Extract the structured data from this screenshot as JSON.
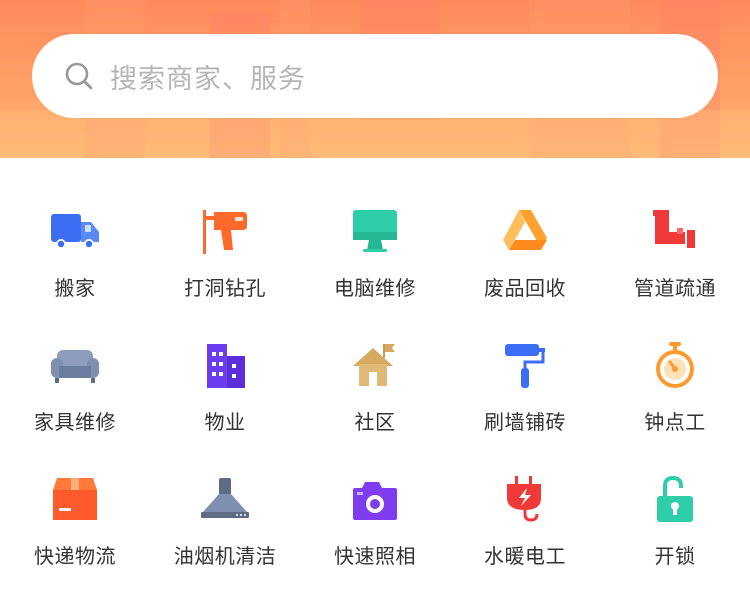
{
  "search": {
    "placeholder": "搜索商家、服务"
  },
  "services": [
    {
      "label": "搬家",
      "icon": "truck-icon"
    },
    {
      "label": "打洞钻孔",
      "icon": "drill-icon"
    },
    {
      "label": "电脑维修",
      "icon": "monitor-icon"
    },
    {
      "label": "废品回收",
      "icon": "recycle-icon"
    },
    {
      "label": "管道疏通",
      "icon": "pipe-icon"
    },
    {
      "label": "家具维修",
      "icon": "sofa-icon"
    },
    {
      "label": "物业",
      "icon": "building-icon"
    },
    {
      "label": "社区",
      "icon": "house-flag-icon"
    },
    {
      "label": "刷墙铺砖",
      "icon": "paint-roller-icon"
    },
    {
      "label": "钟点工",
      "icon": "stopwatch-icon"
    },
    {
      "label": "快递物流",
      "icon": "package-icon"
    },
    {
      "label": "油烟机清洁",
      "icon": "range-hood-icon"
    },
    {
      "label": "快速照相",
      "icon": "camera-icon"
    },
    {
      "label": "水暖电工",
      "icon": "plug-icon"
    },
    {
      "label": "开锁",
      "icon": "unlock-icon"
    }
  ],
  "colors": {
    "header_top": "#ff8a5c",
    "header_bottom": "#ffb874",
    "truck": "#3b6ef5",
    "drill": "#ff6a2b",
    "monitor": "#2ecfa8",
    "recycle": "#ffa12e",
    "pipe": "#f03a3a",
    "sofa": "#7e8fb0",
    "building": "#6a3ef0",
    "house": "#d7a860",
    "roller": "#3b6ef5",
    "stopwatch": "#ff9a2e",
    "package": "#ff5a2b",
    "hood": "#5e6b84",
    "camera": "#7e3ef0",
    "plug": "#f03a3a",
    "lock": "#2ecfa8"
  }
}
